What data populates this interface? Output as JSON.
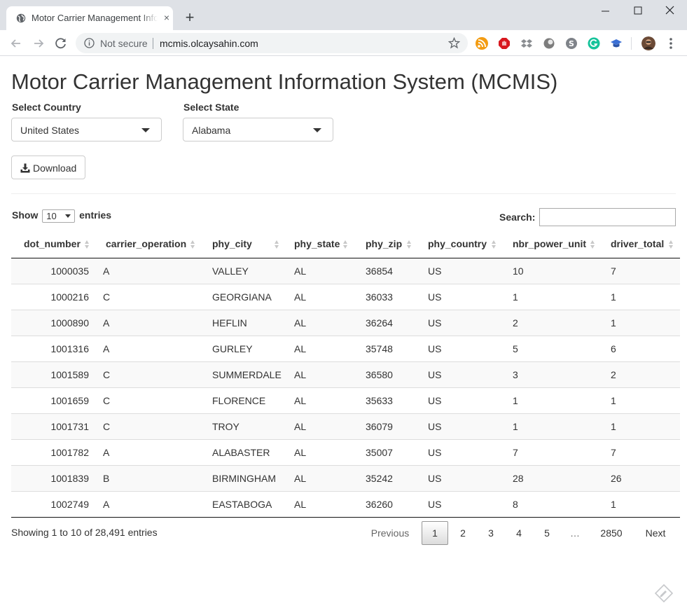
{
  "browser": {
    "tab_title": "Motor Carrier Management Information System",
    "tab_close_glyph": "×",
    "new_tab_glyph": "+",
    "security_label": "Not secure",
    "url": "mcmis.olcaysahin.com",
    "icons": [
      "globe-icon",
      "back-arrow-icon",
      "forward-arrow-icon",
      "reload-icon",
      "info-icon",
      "star-icon",
      "rss-icon",
      "adblock-icon",
      "dropbox-icon",
      "extension-circle-icon",
      "skype-icon",
      "grammarly-icon",
      "graduation-cap-icon",
      "profile-avatar-icon",
      "menu-dots-icon"
    ],
    "colors": {
      "tabbar": "#dee1e6",
      "omnibox": "#f1f3f4"
    }
  },
  "page": {
    "title": "Motor Carrier Management Information System (MCMIS)",
    "country_label": "Select Country",
    "country_value": "United States",
    "state_label": "Select State",
    "state_value": "Alabama",
    "download_label": "Download"
  },
  "table_controls": {
    "show_label": "Show",
    "entries_label": "entries",
    "page_length": "10",
    "search_label": "Search:",
    "search_value": ""
  },
  "table": {
    "columns": [
      "dot_number",
      "carrier_operation",
      "phy_city",
      "phy_state",
      "phy_zip",
      "phy_country",
      "nbr_power_unit",
      "driver_total"
    ],
    "rows": [
      [
        "1000035",
        "A",
        "VALLEY",
        "AL",
        "36854",
        "US",
        "10",
        "7"
      ],
      [
        "1000216",
        "C",
        "GEORGIANA",
        "AL",
        "36033",
        "US",
        "1",
        "1"
      ],
      [
        "1000890",
        "A",
        "HEFLIN",
        "AL",
        "36264",
        "US",
        "2",
        "1"
      ],
      [
        "1001316",
        "A",
        "GURLEY",
        "AL",
        "35748",
        "US",
        "5",
        "6"
      ],
      [
        "1001589",
        "C",
        "SUMMERDALE",
        "AL",
        "36580",
        "US",
        "3",
        "2"
      ],
      [
        "1001659",
        "C",
        "FLORENCE",
        "AL",
        "35633",
        "US",
        "1",
        "1"
      ],
      [
        "1001731",
        "C",
        "TROY",
        "AL",
        "36079",
        "US",
        "1",
        "1"
      ],
      [
        "1001782",
        "A",
        "ALABASTER",
        "AL",
        "35007",
        "US",
        "7",
        "7"
      ],
      [
        "1001839",
        "B",
        "BIRMINGHAM",
        "AL",
        "35242",
        "US",
        "28",
        "26"
      ],
      [
        "1002749",
        "A",
        "EASTABOGA",
        "AL",
        "36260",
        "US",
        "8",
        "1"
      ]
    ]
  },
  "pagination": {
    "info": "Showing 1 to 10 of 28,491 entries",
    "previous": "Previous",
    "pages": [
      "1",
      "2",
      "3",
      "4",
      "5"
    ],
    "ellipsis": "…",
    "last_page": "2850",
    "next": "Next",
    "current": "1"
  }
}
